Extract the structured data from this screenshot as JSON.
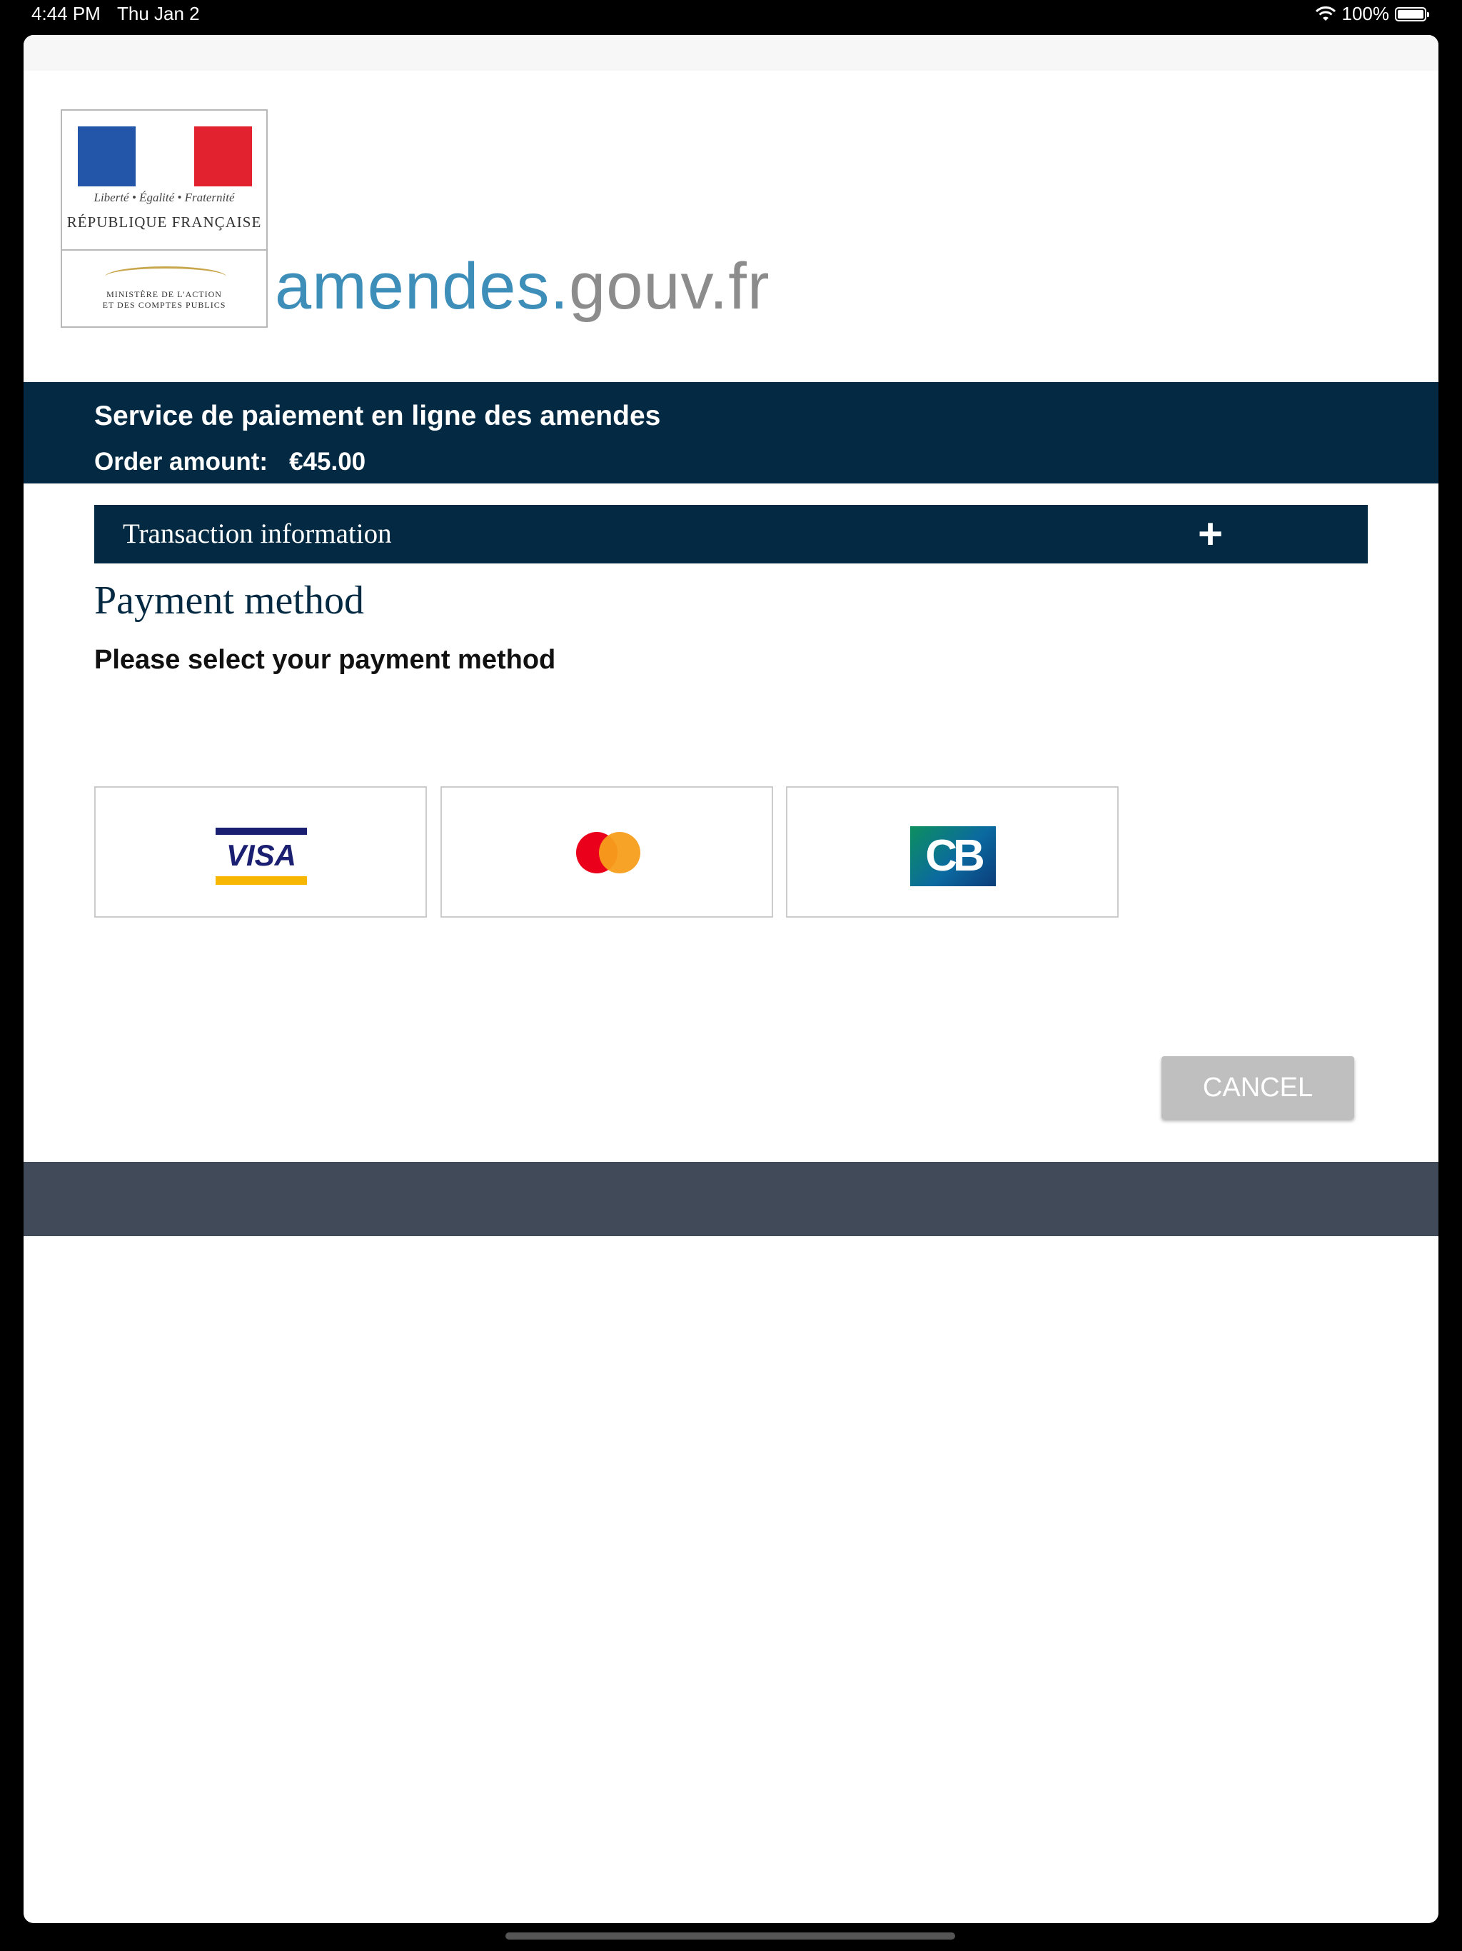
{
  "status_bar": {
    "time": "4:44 PM",
    "date": "Thu Jan 2",
    "battery": "100%"
  },
  "logo": {
    "motto": "Liberté • Égalité • Fraternité",
    "republic": "RÉPUBLIQUE FRANÇAISE",
    "ministry_line1": "MINISTÈRE DE L'ACTION",
    "ministry_line2": "ET DES COMPTES PUBLICS",
    "site_part1": "amendes.",
    "site_part2": "gouv.fr"
  },
  "banner": {
    "title": "Service de paiement en ligne des amendes",
    "order_label": "Order amount:",
    "order_amount": "€45.00"
  },
  "transaction": {
    "label": "Transaction information",
    "toggle": "+"
  },
  "payment": {
    "title": "Payment method",
    "subtitle": "Please select your payment method",
    "methods": [
      {
        "name": "Visa",
        "text": "VISA"
      },
      {
        "name": "Mastercard"
      },
      {
        "name": "CB",
        "text": "CB"
      }
    ]
  },
  "actions": {
    "cancel": "CANCEL"
  },
  "colors": {
    "navy": "#032a42",
    "footer": "#414a59",
    "cancel_bg": "#bfbfbf"
  }
}
